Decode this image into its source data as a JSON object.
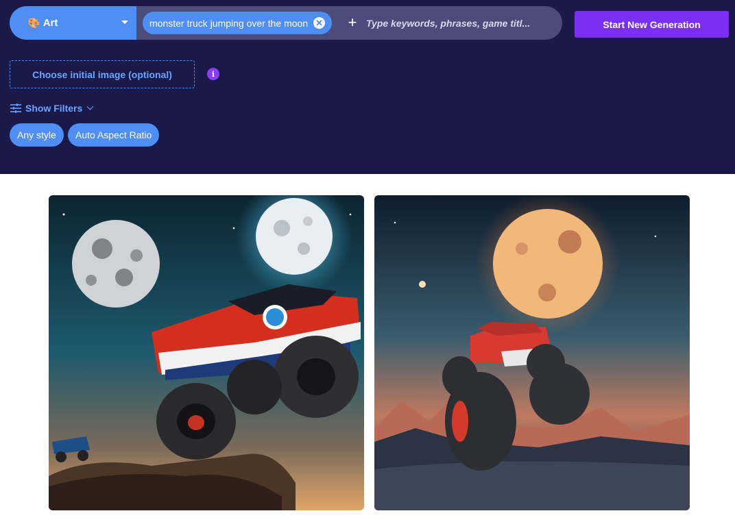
{
  "search": {
    "category": "Art",
    "category_icon": "palette-icon",
    "keyword_chip": "monster truck jumping over the moon",
    "placeholder": "Type keywords, phrases, game titl..."
  },
  "actions": {
    "start_label": "Start New Generation",
    "initial_image_label": "Choose initial image (optional)",
    "info_glyph": "i"
  },
  "filters": {
    "toggle_label": "Show Filters",
    "chips": [
      "Any style",
      "Auto Aspect Ratio"
    ]
  },
  "results": [
    {
      "alt": "monster-truck-red-over-moons"
    },
    {
      "alt": "monster-truck-red-orange-moon"
    }
  ],
  "colors": {
    "header_bg": "#191a4a",
    "accent_blue": "#4f8ff5",
    "accent_purple": "#7b2ff2"
  }
}
